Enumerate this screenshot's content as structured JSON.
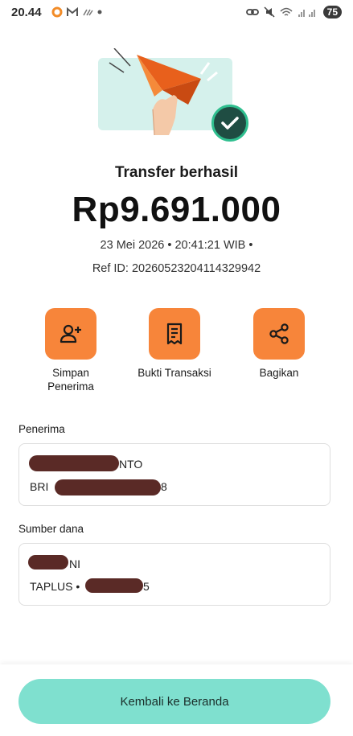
{
  "status_bar": {
    "time": "20.44",
    "battery": "75",
    "icons": [
      "ojol-icon",
      "gmail-icon",
      "wifi-call-icon",
      "dot-icon",
      "link-icon",
      "mute-icon",
      "wifi-icon",
      "signal-icon"
    ]
  },
  "header": {
    "title": "Transfer berhasil",
    "amount": "Rp9.691.000",
    "datetime": "23 Mei 2026 • 20:41:21 WIB •",
    "ref_id": "Ref ID: 20260523204114329942"
  },
  "actions": [
    {
      "label": "Simpan Penerima",
      "icon": "add-user-icon"
    },
    {
      "label": "Bukti Transaksi",
      "icon": "receipt-icon"
    },
    {
      "label": "Bagikan",
      "icon": "share-icon"
    }
  ],
  "recipient": {
    "label": "Penerima",
    "name_suffix": "NTO",
    "bank_prefix": "BRI",
    "account_suffix": "8"
  },
  "source": {
    "label": "Sumber dana",
    "name_suffix": "NI",
    "account_prefix": "TAPLUS •",
    "account_suffix": "5"
  },
  "footer": {
    "button_label": "Kembali ke Beranda"
  },
  "colors": {
    "accent_orange": "#f7853a",
    "success_green": "#2fbf8f",
    "button_teal": "#7fe0cf",
    "redaction": "#5a2a26"
  }
}
